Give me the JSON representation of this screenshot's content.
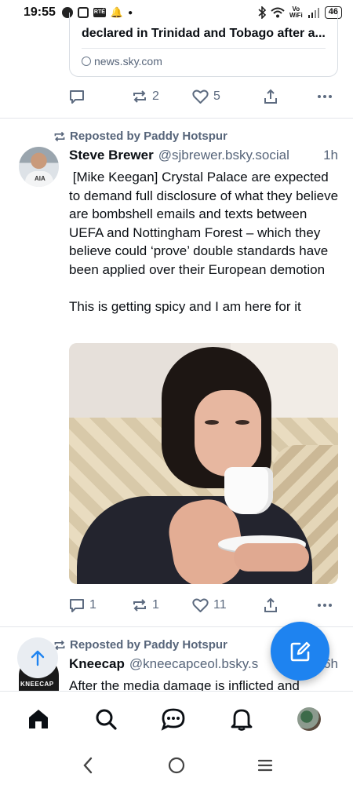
{
  "status_bar": {
    "time": "19:55",
    "volte": "Vo\nWiFi",
    "battery": "46"
  },
  "prev_post": {
    "link_title": "declared in Trinidad and Tobago after a...",
    "link_domain": "news.sky.com",
    "reply_count": "",
    "repost_count": "2",
    "like_count": "5"
  },
  "post1": {
    "repost_label": "Reposted by Paddy Hotspur",
    "author": "Steve Brewer",
    "handle": "@sjbrewer.bsky.social",
    "time": "1h",
    "text": " [Mike Keegan] Crystal Palace are expected to demand full disclosure of what they believe are bombshell emails and texts between UEFA and Nottingham Forest – which they believe could ‘prove’ double standards have been applied over their European demotion\n\nThis is getting spicy and I am here for it",
    "reply_count": "1",
    "repost_count": "1",
    "like_count": "11"
  },
  "post2": {
    "repost_label": "Reposted by Paddy Hotspur",
    "author": "Kneecap",
    "handle": "@kneecapceol.bsky.s",
    "time": "6h",
    "text": "After the media damage is inflicted and",
    "avatar_text": "KNEECAP"
  },
  "icons": {
    "reply": "reply-icon",
    "repost": "repost-icon",
    "like": "heart-icon",
    "share": "share-icon",
    "more": "more-icon"
  },
  "colors": {
    "accent": "#1e83f0",
    "muted": "#57657a",
    "text": "#0b0f14"
  }
}
